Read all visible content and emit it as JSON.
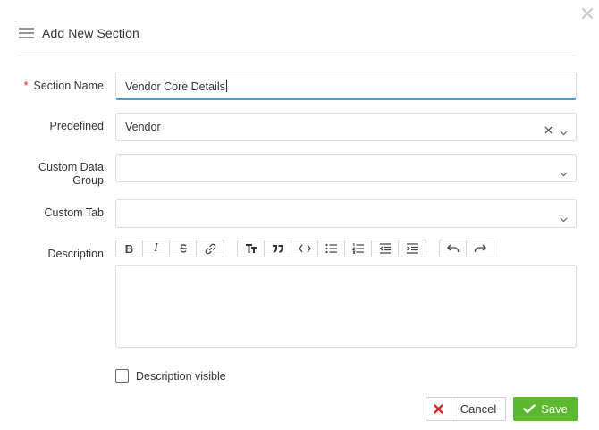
{
  "dialog": {
    "title": "Add New Section"
  },
  "form": {
    "section_name": {
      "label": "Section Name",
      "required_mark": "*",
      "value": "Vendor Core Details"
    },
    "predefined": {
      "label": "Predefined",
      "value": "Vendor"
    },
    "custom_data_group": {
      "label_line1": "Custom Data",
      "label_line2": "Group",
      "value": ""
    },
    "custom_tab": {
      "label": "Custom Tab",
      "value": ""
    },
    "description": {
      "label": "Description",
      "value": ""
    },
    "description_visible": {
      "label": "Description visible",
      "checked": false
    }
  },
  "toolbar": {
    "groups": [
      [
        "bold-icon",
        "italic-icon",
        "strikethrough-icon",
        "link-icon"
      ],
      [
        "text-size-icon",
        "quote-icon",
        "code-icon",
        "bullet-list-icon",
        "numbered-list-icon",
        "outdent-icon",
        "indent-icon"
      ],
      [
        "undo-icon",
        "redo-icon"
      ]
    ],
    "bold_glyph": "B",
    "italic_glyph": "I"
  },
  "actions": {
    "cancel_label": "Cancel",
    "save_label": "Save"
  },
  "colors": {
    "accent_blue": "#3aa1d8",
    "save_green": "#5cb82f",
    "cancel_red": "#e0262a",
    "required_red": "#e0262a"
  }
}
